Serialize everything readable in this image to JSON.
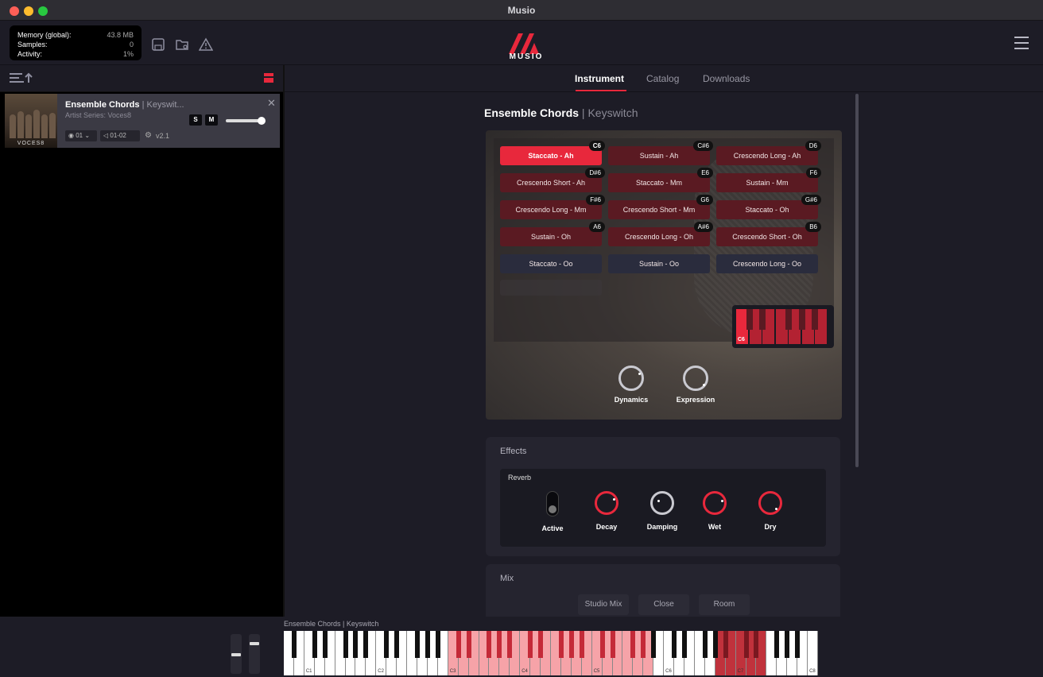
{
  "window": {
    "title": "Musio"
  },
  "stats": {
    "memory_label": "Memory (global):",
    "memory_value": "43.8 MB",
    "samples_label": "Samples:",
    "samples_value": "0",
    "activity_label": "Activity:",
    "activity_value": "1%"
  },
  "logo": {
    "text": "MUSIO",
    "color": "#e8283c"
  },
  "tabs": [
    {
      "label": "Instrument",
      "active": true
    },
    {
      "label": "Catalog",
      "active": false
    },
    {
      "label": "Downloads",
      "active": false
    }
  ],
  "track": {
    "name": "Ensemble Chords",
    "keyswitch": "Keyswit...",
    "series": "Artist Series: Voces8",
    "thumb_label": "VOCES8",
    "solo_label": "S",
    "mute_label": "M",
    "midi_channel": "01",
    "audio_out": "01-02",
    "version": "v2.1",
    "volume": 0.85
  },
  "instrument": {
    "name": "Ensemble Chords",
    "preset": "Keyswitch",
    "articulations": [
      {
        "label": "Staccato - Ah",
        "note": "C6",
        "state": "selected"
      },
      {
        "label": "Sustain - Ah",
        "note": "C#6",
        "state": "dark"
      },
      {
        "label": "Crescendo Long - Ah",
        "note": "D6",
        "state": "dark"
      },
      {
        "label": "Crescendo Short - Ah",
        "note": "D#6",
        "state": "dark"
      },
      {
        "label": "Staccato - Mm",
        "note": "E6",
        "state": "dark"
      },
      {
        "label": "Sustain - Mm",
        "note": "F6",
        "state": "dark"
      },
      {
        "label": "Crescendo Long - Mm",
        "note": "F#6",
        "state": "dark"
      },
      {
        "label": "Crescendo Short - Mm",
        "note": "G6",
        "state": "dark"
      },
      {
        "label": "Staccato - Oh",
        "note": "G#6",
        "state": "dark"
      },
      {
        "label": "Sustain - Oh",
        "note": "A6",
        "state": "dark"
      },
      {
        "label": "Crescendo Long - Oh",
        "note": "A#6",
        "state": "dark"
      },
      {
        "label": "Crescendo Short - Oh",
        "note": "B6",
        "state": "dark"
      },
      {
        "label": "Staccato - Oo",
        "note": "",
        "state": "blue"
      },
      {
        "label": "Sustain - Oo",
        "note": "",
        "state": "blue"
      },
      {
        "label": "Crescendo Long - Oo",
        "note": "",
        "state": "blue"
      }
    ],
    "mini_keyboard_note": "C6",
    "knobs": [
      {
        "label": "Dynamics"
      },
      {
        "label": "Expression"
      }
    ]
  },
  "effects": {
    "title": "Effects",
    "reverb": {
      "title": "Reverb",
      "active_label": "Active",
      "knobs": [
        "Decay",
        "Damping",
        "Wet",
        "Dry"
      ]
    }
  },
  "mix": {
    "title": "Mix",
    "options": [
      "Studio Mix",
      "Close",
      "Room"
    ]
  },
  "keyboard": {
    "title_name": "Ensemble Chords",
    "title_preset": "Keyswitch",
    "octave_labels": [
      "C1",
      "C2",
      "C3",
      "C4",
      "C5",
      "C6",
      "C7",
      "C8"
    ]
  },
  "colors": {
    "accent": "#e8283c",
    "background": "#1d1c26"
  }
}
